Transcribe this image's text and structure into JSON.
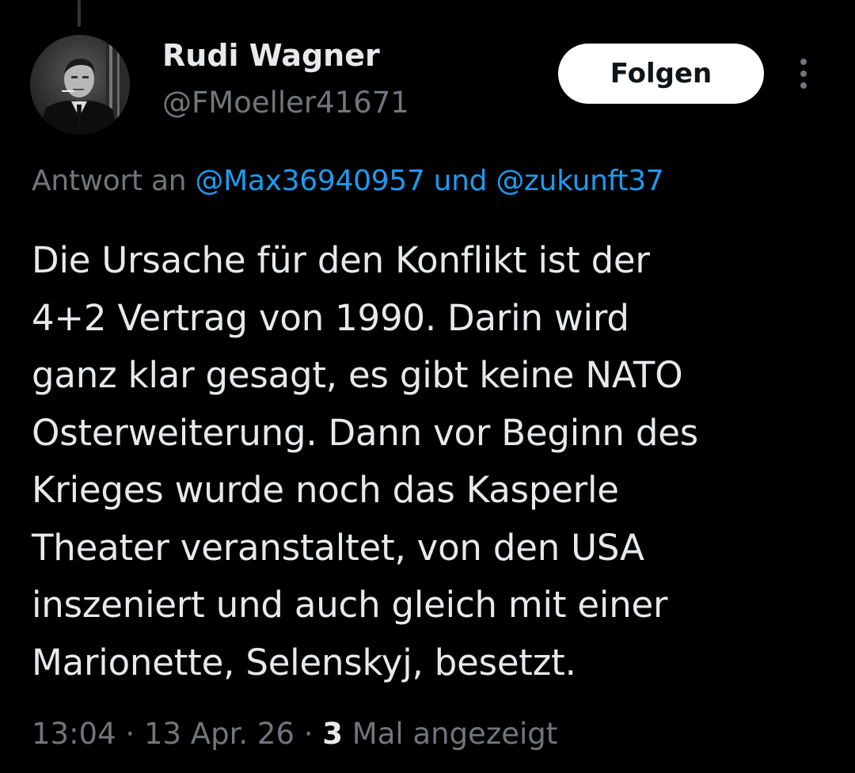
{
  "author": {
    "name": "Rudi Wagner",
    "handle": "@FMoeller41671",
    "avatar_icon": "profile-photo"
  },
  "header": {
    "follow_label": "Folgen",
    "more_icon": "vertical-ellipsis-icon"
  },
  "reply": {
    "prefix": "Antwort an ",
    "mention_1": "@Max36940957",
    "connector": " und ",
    "mention_2": "@zukunft37"
  },
  "tweet": {
    "text": "Die Ursache für den Konflikt ist der\n4+2 Vertrag von 1990. Darin wird\nganz klar gesagt, es gibt keine NATO\nOsterweiterung. Dann vor Beginn des\nKrieges wurde noch das Kasperle\nTheater veranstaltet, von den USA\ninszeniert und auch gleich mit einer\nMarionette, Selenskyj, besetzt."
  },
  "meta": {
    "time": "13:04",
    "separator": " · ",
    "date": "13 Apr. 26",
    "views_count": "3",
    "views_label": " Mal angezeigt"
  },
  "colors": {
    "background": "#000000",
    "text_primary": "#e7e9ea",
    "text_secondary": "#71767b",
    "link": "#1d9bf0",
    "button_bg": "#ffffff"
  }
}
